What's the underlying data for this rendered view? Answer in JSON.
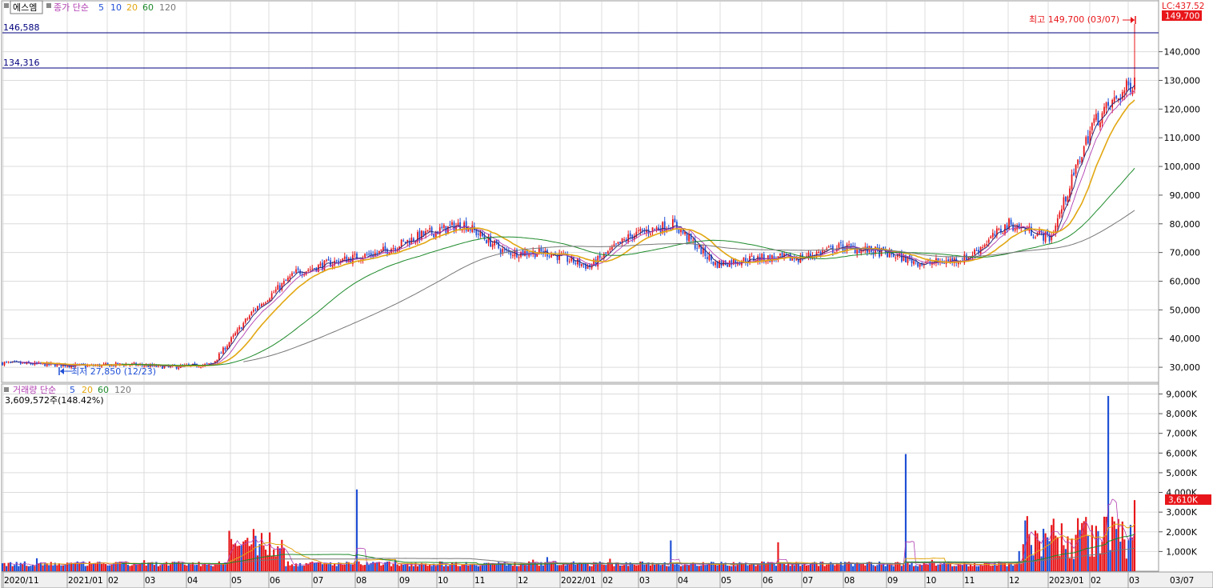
{
  "price_panel": {
    "stock_name": "에스엠",
    "legend_label": "종가 단순",
    "ma_periods": [
      "5",
      "10",
      "20",
      "60",
      "120"
    ],
    "hline_1": "146,588",
    "hline_2": "134,316",
    "max_note": "최고 149,700 (03/07)",
    "min_note": "최저 27,850 (12/23)",
    "corner_label": "LC:437.52",
    "current_price_badge": "149,700"
  },
  "volume_panel": {
    "legend_label": "거래량 단순",
    "ma_periods": [
      "5",
      "20",
      "60",
      "120"
    ],
    "current_volume": "3,609,572주(148.42%)",
    "current_volume_badge": "3,610K"
  },
  "colors": {
    "up": "#e8161a",
    "down": "#1f4fd6",
    "ma5": "#2a2a7a",
    "ma10": "#b13fb1",
    "ma20": "#e2a712",
    "ma60": "#1d8a2a",
    "ma120": "#777777",
    "hline": "#00007f",
    "grid": "#dcdcdc",
    "legend_ma5": "#1f4fd6",
    "legend_ma10": "#1f4fd6",
    "legend_ma20": "#e2a712",
    "legend_ma60": "#1d8a2a",
    "legend_ma120": "#777777"
  },
  "chart_data": [
    {
      "type": "candlestick",
      "y_axis_ticks": [
        "30,000",
        "40,000",
        "50,000",
        "60,000",
        "70,000",
        "80,000",
        "90,000",
        "100,000",
        "110,000",
        "120,000",
        "130,000",
        "140,000"
      ],
      "ylim": [
        25000,
        153000
      ],
      "hlines": [
        146588,
        134316
      ],
      "max": {
        "value": 149700,
        "date": "03/07"
      },
      "min": {
        "value": 27850,
        "date": "12/23"
      },
      "approx_close_path": [
        {
          "x": "2020/11",
          "close": 31500
        },
        {
          "x": "2021/01",
          "close": 31000
        },
        {
          "x": "02",
          "close": 30500
        },
        {
          "x": "03",
          "close": 31000
        },
        {
          "x": "04",
          "close": 30000
        },
        {
          "x": "05",
          "close": 31000
        },
        {
          "x": "06",
          "close": 50000
        },
        {
          "x": "07",
          "close": 63000
        },
        {
          "x": "08",
          "close": 67000
        },
        {
          "x": "09",
          "close": 70000
        },
        {
          "x": "10",
          "close": 76000
        },
        {
          "x": "11",
          "close": 80000
        },
        {
          "x": "12",
          "close": 70000
        },
        {
          "x": "2022/01",
          "close": 70000
        },
        {
          "x": "02",
          "close": 65000
        },
        {
          "x": "03",
          "close": 76000
        },
        {
          "x": "04",
          "close": 80000
        },
        {
          "x": "05",
          "close": 66000
        },
        {
          "x": "06",
          "close": 68000
        },
        {
          "x": "07",
          "close": 68000
        },
        {
          "x": "08",
          "close": 72000
        },
        {
          "x": "09",
          "close": 70000
        },
        {
          "x": "10",
          "close": 66000
        },
        {
          "x": "11",
          "close": 68000
        },
        {
          "x": "12",
          "close": 80000
        },
        {
          "x": "2023/01",
          "close": 75000
        },
        {
          "x": "02",
          "close": 115000
        },
        {
          "x": "03",
          "close": 130000
        }
      ]
    },
    {
      "type": "bar",
      "y_axis_ticks": [
        "1,000K",
        "2,000K",
        "3,000K",
        "4,000K",
        "5,000K",
        "6,000K",
        "7,000K",
        "8,000K",
        "9,000K"
      ],
      "ylim": [
        0,
        9100
      ],
      "current_volume_k": 3610
    }
  ],
  "x_axis": {
    "labels": [
      "2020/11",
      "2021/01",
      "02",
      "03",
      "04",
      "05",
      "06",
      "07",
      "08",
      "09",
      "10",
      "11",
      "12",
      "2022/01",
      "02",
      "03",
      "04",
      "05",
      "06",
      "07",
      "08",
      "09",
      "10",
      "11",
      "12",
      "2023/01",
      "02",
      "03"
    ],
    "last_label": "03/07"
  }
}
